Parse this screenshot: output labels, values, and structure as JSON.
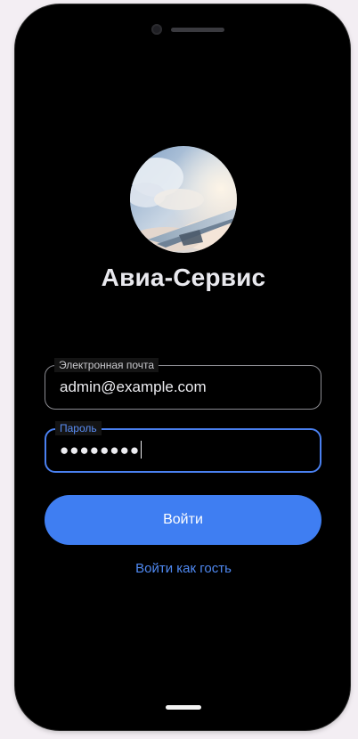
{
  "app": {
    "title": "Авиа-Сервис",
    "avatar_icon": "airplane-wing-clouds-image"
  },
  "form": {
    "email": {
      "label": "Электронная почта",
      "value": "admin@example.com"
    },
    "password": {
      "label": "Пароль",
      "value": "●●●●●●●●"
    }
  },
  "actions": {
    "login_label": "Войти",
    "guest_label": "Войти как гость"
  },
  "colors": {
    "accent": "#3f7ef2",
    "background": "#141414",
    "focused_border": "#4a80f0"
  }
}
